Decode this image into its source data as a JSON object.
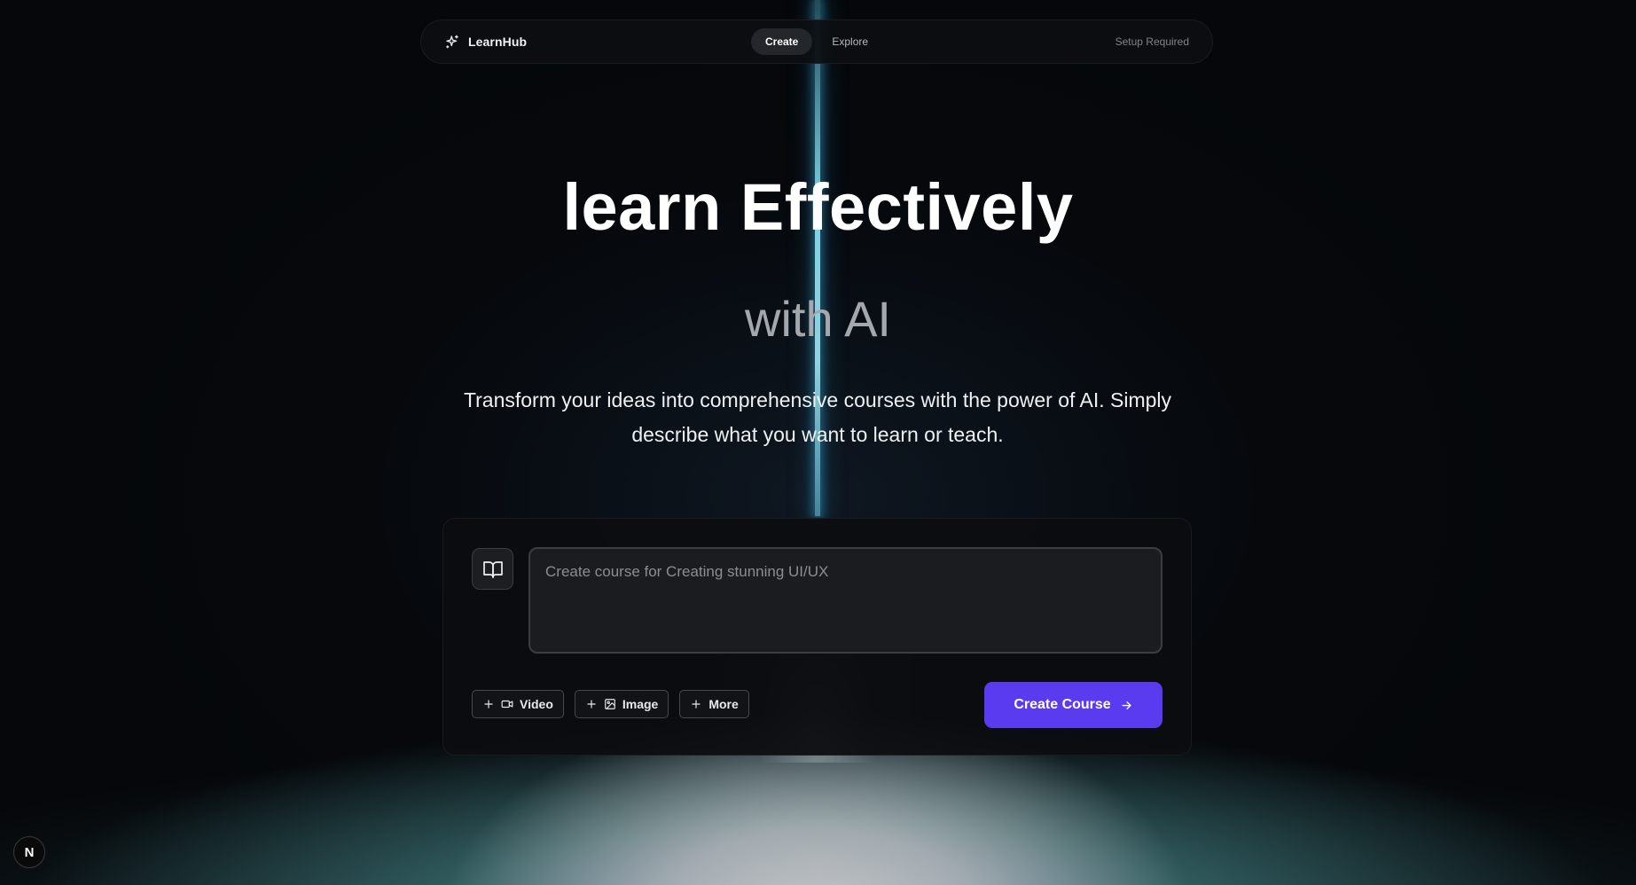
{
  "nav": {
    "brand_name": "LearnHub",
    "links": [
      {
        "label": "Create",
        "active": true
      },
      {
        "label": "Explore",
        "active": false
      }
    ],
    "status": "Setup Required"
  },
  "hero": {
    "title": "learn Effectively",
    "subtitle": "with AI",
    "description": "Transform your ideas into comprehensive courses with the power of AI. Simply describe what you want to learn or teach."
  },
  "composer": {
    "placeholder": "Create course for Creating stunning UI/UX",
    "value": "",
    "chips": [
      {
        "label": "Video",
        "icon": "video-icon"
      },
      {
        "label": "Image",
        "icon": "image-icon"
      },
      {
        "label": "More",
        "icon": "plus-icon"
      }
    ],
    "submit_label": "Create Course"
  },
  "corner_badge": {
    "letter": "N"
  },
  "colors": {
    "accent": "#5b3bf0",
    "background": "#05070a",
    "beam": "#8fdcf0"
  }
}
